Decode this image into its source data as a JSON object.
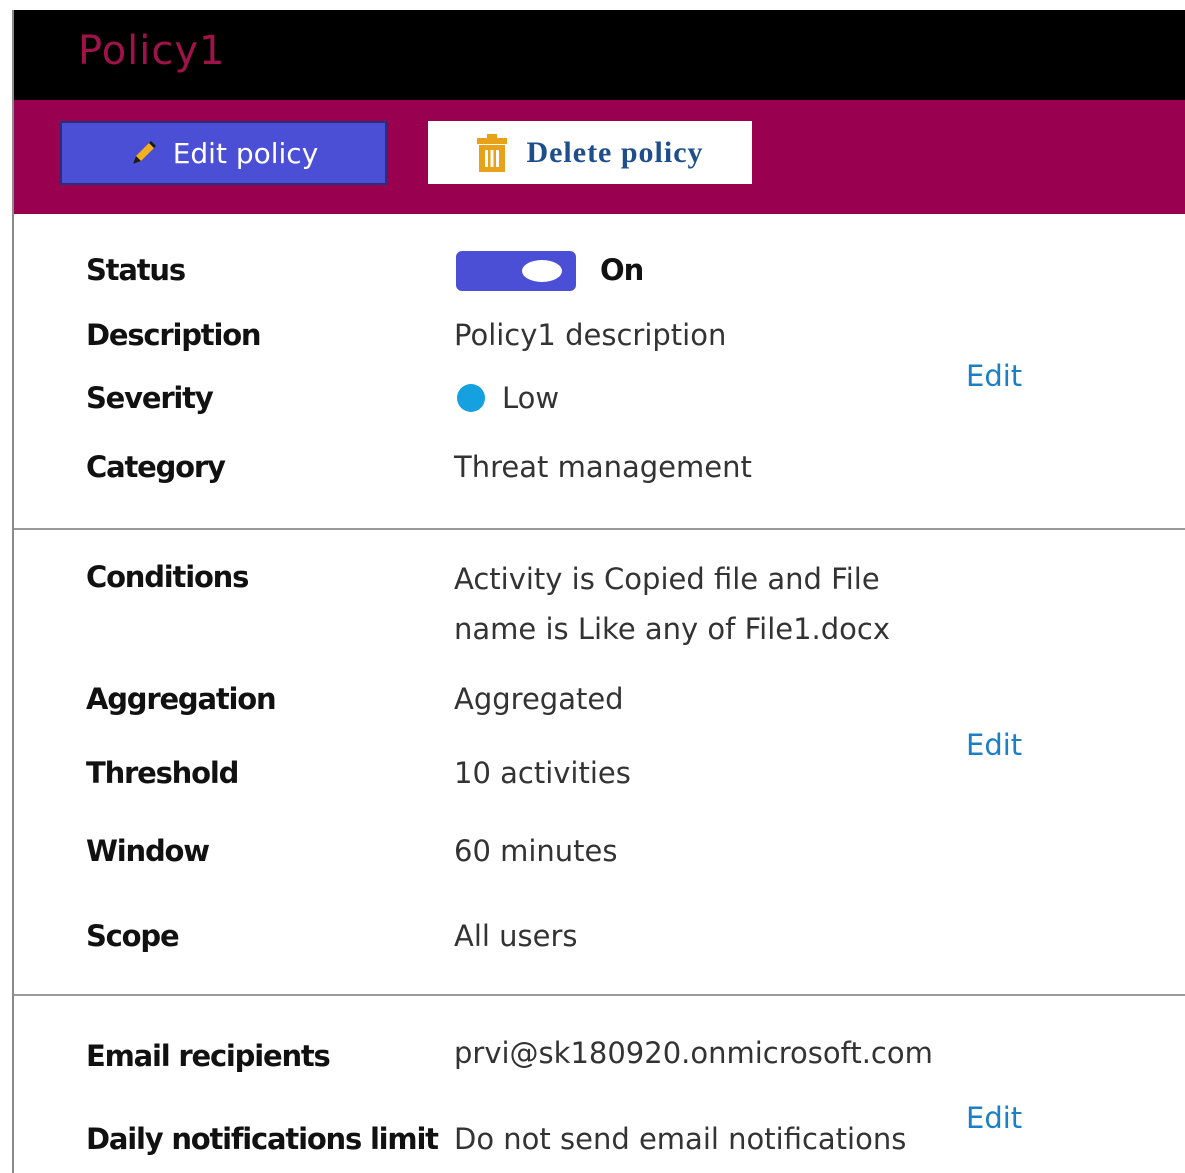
{
  "header": {
    "title": "Policy1"
  },
  "toolbar": {
    "edit_label": "Edit policy",
    "edit_icon": "pencil-icon",
    "delete_label": "Delete policy",
    "delete_icon": "trash-icon"
  },
  "general": {
    "status_label": "Status",
    "status_value": "On",
    "status_on": true,
    "description_label": "Description",
    "description_value": "Policy1 description",
    "severity_label": "Severity",
    "severity_value": "Low",
    "severity_color": "#15a0e0",
    "category_label": "Category",
    "category_value": "Threat management",
    "edit_label": "Edit"
  },
  "conditions": {
    "conditions_label": "Conditions",
    "conditions_value": "Activity is Copied file and File name is Like any of File1.docx",
    "aggregation_label": "Aggregation",
    "aggregation_value": "Aggregated",
    "threshold_label": "Threshold",
    "threshold_value": "10 activities",
    "window_label": "Window",
    "window_value": "60 minutes",
    "scope_label": "Scope",
    "scope_value": "All users",
    "edit_label": "Edit"
  },
  "notifications": {
    "recipients_label": "Email recipients",
    "recipients_value": "prvi@sk180920.onmicrosoft.com",
    "limit_label": "Daily notifications limit",
    "limit_value": "Do not send email notifications",
    "edit_label": "Edit"
  },
  "colors": {
    "titlebar": "#000000",
    "title_text": "#a0134a",
    "toolbar": "#990050",
    "edit_button": "#4a4fd6",
    "delete_text": "#1f4e8c",
    "link": "#1a7fc4",
    "toggle": "#4a4fd6"
  }
}
